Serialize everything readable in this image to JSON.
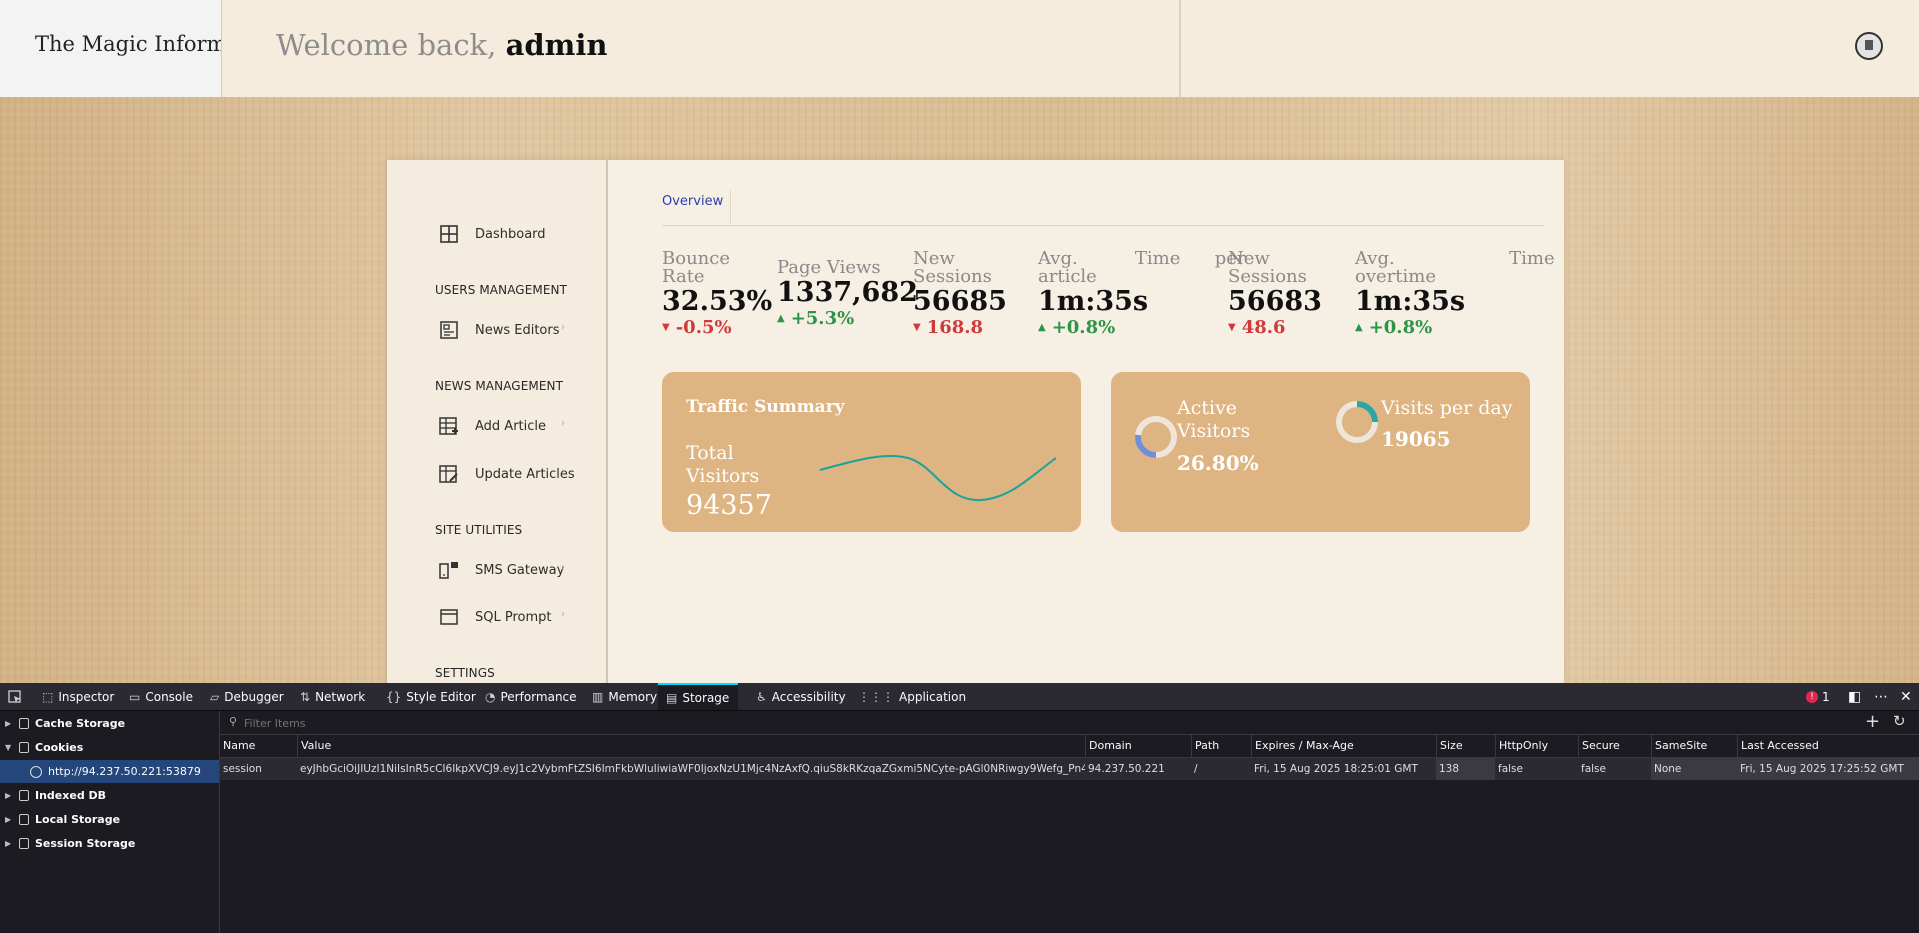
{
  "brand": {
    "name": "The Magic Information"
  },
  "header": {
    "welcome": "Welcome back,",
    "user": "admin"
  },
  "sidebar": {
    "dashboard": "Dashboard",
    "users_heading": "USERS MANAGEMENT",
    "news_editors": "News Editors",
    "news_heading": "NEWS MANAGEMENT",
    "add_article": "Add Article",
    "update_articles": "Update Articles",
    "site_heading": "SITE UTILITIES",
    "sms_gateway": "SMS Gateway",
    "sql_prompt": "SQL Prompt",
    "settings_heading": "SETTINGS"
  },
  "main": {
    "tab_overview": "Overview",
    "stats": [
      {
        "label1": "Bounce",
        "label2": "Rate",
        "value": "32.53%",
        "change": "-0.5%",
        "dir": "down"
      },
      {
        "label1": "Page Views",
        "label2": "",
        "value": "1337,682",
        "change": "+5.3%",
        "dir": "up"
      },
      {
        "label1": "New",
        "label2": "Sessions",
        "value": "56685",
        "change": "168.8",
        "dir": "down"
      },
      {
        "label1": "Avg.          Time      per",
        "label2": "article",
        "value": "1m:35s",
        "change": "+0.8%",
        "dir": "up"
      },
      {
        "label1": "New",
        "label2": "Sessions",
        "value": "56683",
        "change": "48.6",
        "dir": "down"
      },
      {
        "label1": "Avg.                    Time",
        "label2": "overtime",
        "value": "1m:35s",
        "change": "+0.8%",
        "dir": "up"
      }
    ],
    "traffic": {
      "title": "Traffic Summary",
      "label1": "Total",
      "label2": "Visitors",
      "value": "94357",
      "line_color": "#1aa39a"
    },
    "active": {
      "label1": "Active",
      "label2": "Visitors",
      "value": "26.80%",
      "fraction": 0.268,
      "ring_color": "#6f8fd6"
    },
    "visits": {
      "label": "Visits per day",
      "value": "19065",
      "ring_color": "#2ca6a4"
    }
  },
  "devtools": {
    "tabs": [
      "Inspector",
      "Console",
      "Debugger",
      "Network",
      "Style Editor",
      "Performance",
      "Memory",
      "Storage",
      "Accessibility",
      "Application"
    ],
    "active_tab": "Storage",
    "error_count": "1",
    "tree": {
      "cache": "Cache Storage",
      "cookies": "Cookies",
      "host": "http://94.237.50.221:53879",
      "indexed": "Indexed DB",
      "local": "Local Storage",
      "session": "Session Storage"
    },
    "filter_placeholder": "Filter Items",
    "columns": [
      "Name",
      "Value",
      "Domain",
      "Path",
      "Expires / Max-Age",
      "Size",
      "HttpOnly",
      "Secure",
      "SameSite",
      "Last Accessed"
    ],
    "cookie": {
      "name": "session",
      "value": "eyJhbGciOiJIUzI1NiIsInR5cCI6IkpXVCJ9.eyJ1c2VybmFtZSI6ImFkbWluIiwiaWF0IjoxNzU1Mjc4NzAxfQ.qiuS8kRKzqaZGxmi5NCyte-pAGl0NRiwgy9Wefg_Pn4",
      "domain": "94.237.50.221",
      "path": "/",
      "expires": "Fri, 15 Aug 2025 18:25:01 GMT",
      "size": "138",
      "httponly": "false",
      "secure": "false",
      "samesite": "None",
      "last_accessed": "Fri, 15 Aug 2025 17:25:52 GMT"
    }
  }
}
